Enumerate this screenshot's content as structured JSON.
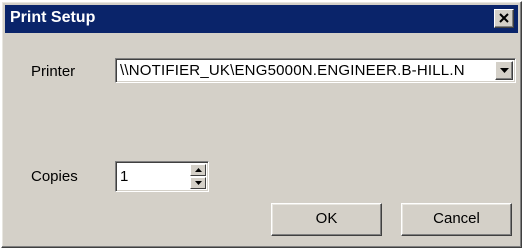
{
  "window": {
    "title": "Print Setup"
  },
  "printer": {
    "label": "Printer",
    "value": "\\\\NOTIFIER_UK\\ENG5000N.ENGINEER.B-HILL.N"
  },
  "copies": {
    "label": "Copies",
    "value": "1"
  },
  "buttons": {
    "ok_label": "OK",
    "cancel_label": "Cancel"
  },
  "icons": {
    "close": "close-icon",
    "dropdown": "chevron-down-icon",
    "spin_up": "spin-up-icon",
    "spin_down": "spin-down-icon"
  },
  "colors": {
    "titlebar": "#0a246a",
    "dialog_face": "#d4d0c8"
  }
}
